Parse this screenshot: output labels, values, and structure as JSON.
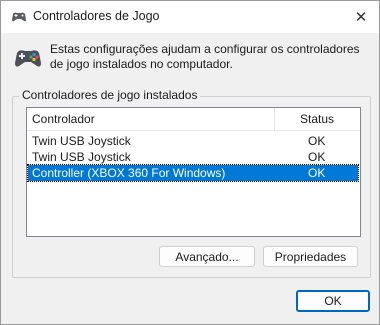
{
  "window": {
    "title": "Controladores de Jogo",
    "close_glyph": "✕"
  },
  "description": "Estas configurações ajudam a configurar os controladores de jogo instalados no computador.",
  "group": {
    "label": "Controladores de jogo instalados"
  },
  "list": {
    "columns": [
      "Controlador",
      "Status"
    ],
    "rows": [
      {
        "name": "Twin USB Joystick",
        "status": "OK",
        "selected": false
      },
      {
        "name": "Twin USB Joystick",
        "status": "OK",
        "selected": false
      },
      {
        "name": "Controller (XBOX 360 For Windows)",
        "status": "OK",
        "selected": true
      }
    ]
  },
  "buttons": {
    "advanced": "Avançado...",
    "properties": "Propriedades",
    "ok": "OK"
  },
  "icons": {
    "title": "gamepad-icon",
    "header": "gamepad-icon"
  },
  "colors": {
    "selection": "#0078d7",
    "default_button_border": "#0067c0"
  }
}
